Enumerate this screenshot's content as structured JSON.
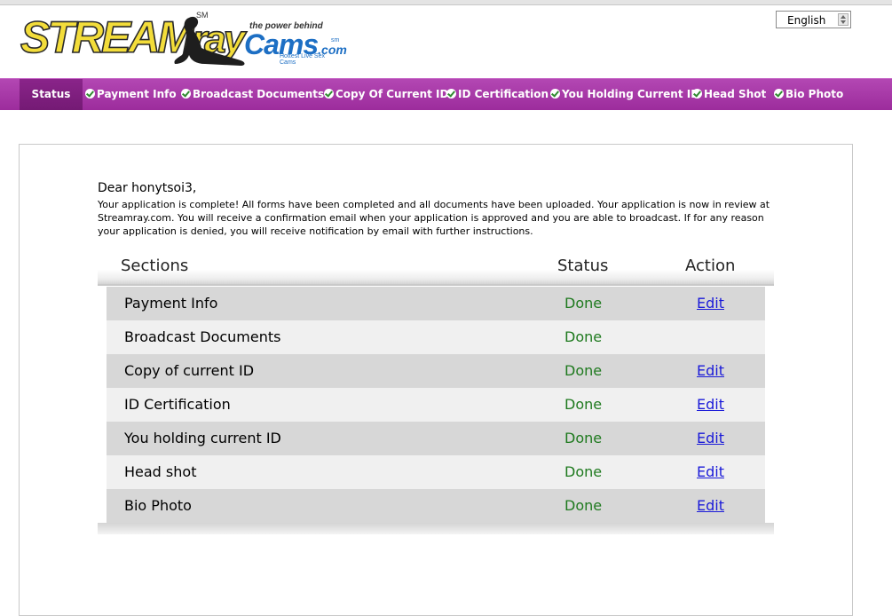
{
  "logo": {
    "brand_upper": "STREAM",
    "brand_lower": "ray",
    "brand_mark": "SM",
    "tagline": "the power behind",
    "partner": "Cams",
    "partner_tld": ".com",
    "partner_mark": "sm",
    "partner_sub": "Hottest Live Sex Cams"
  },
  "language": {
    "selected": "English"
  },
  "nav": {
    "items": [
      {
        "label": "Status",
        "active": true,
        "checked": false
      },
      {
        "label": "Payment Info",
        "checked": true
      },
      {
        "label": "Broadcast Documents",
        "checked": true
      },
      {
        "label": "Copy Of Current ID",
        "checked": true
      },
      {
        "label": "ID Certification",
        "checked": true
      },
      {
        "label": "You Holding Current ID",
        "checked": true
      },
      {
        "label": "Head Shot",
        "checked": true
      },
      {
        "label": "Bio Photo",
        "checked": true
      }
    ]
  },
  "content": {
    "greeting": "Dear honytsoi3,",
    "message": "Your application is complete! All forms have been completed and all documents have been uploaded. Your application is now in review at Streamray.com. You will receive a confirmation email when your application is approved and you are able to broadcast. If for any reason your application is denied, you will receive notification by email with further instructions."
  },
  "table": {
    "headers": {
      "sections": "Sections",
      "status": "Status",
      "action": "Action"
    },
    "rows": [
      {
        "section": "Payment Info",
        "status": "Done",
        "action": "Edit"
      },
      {
        "section": "Broadcast Documents",
        "status": "Done",
        "action": ""
      },
      {
        "section": "Copy of current ID",
        "status": "Done",
        "action": "Edit"
      },
      {
        "section": "ID Certification",
        "status": "Done",
        "action": "Edit"
      },
      {
        "section": "You holding current ID",
        "status": "Done",
        "action": "Edit"
      },
      {
        "section": "Head shot",
        "status": "Done",
        "action": "Edit"
      },
      {
        "section": "Bio Photo",
        "status": "Done",
        "action": "Edit"
      }
    ]
  },
  "colors": {
    "nav_bg": "#a83aa8",
    "nav_active": "#801f80",
    "status_done": "#1f7a1f",
    "link": "#1a1ad8",
    "brand_yellow": "#f3dd3a",
    "cams_blue": "#1d6fc4"
  },
  "icons": {
    "nav_check": "check-circle-icon",
    "lang_spinner": "spinner-arrows-icon"
  }
}
